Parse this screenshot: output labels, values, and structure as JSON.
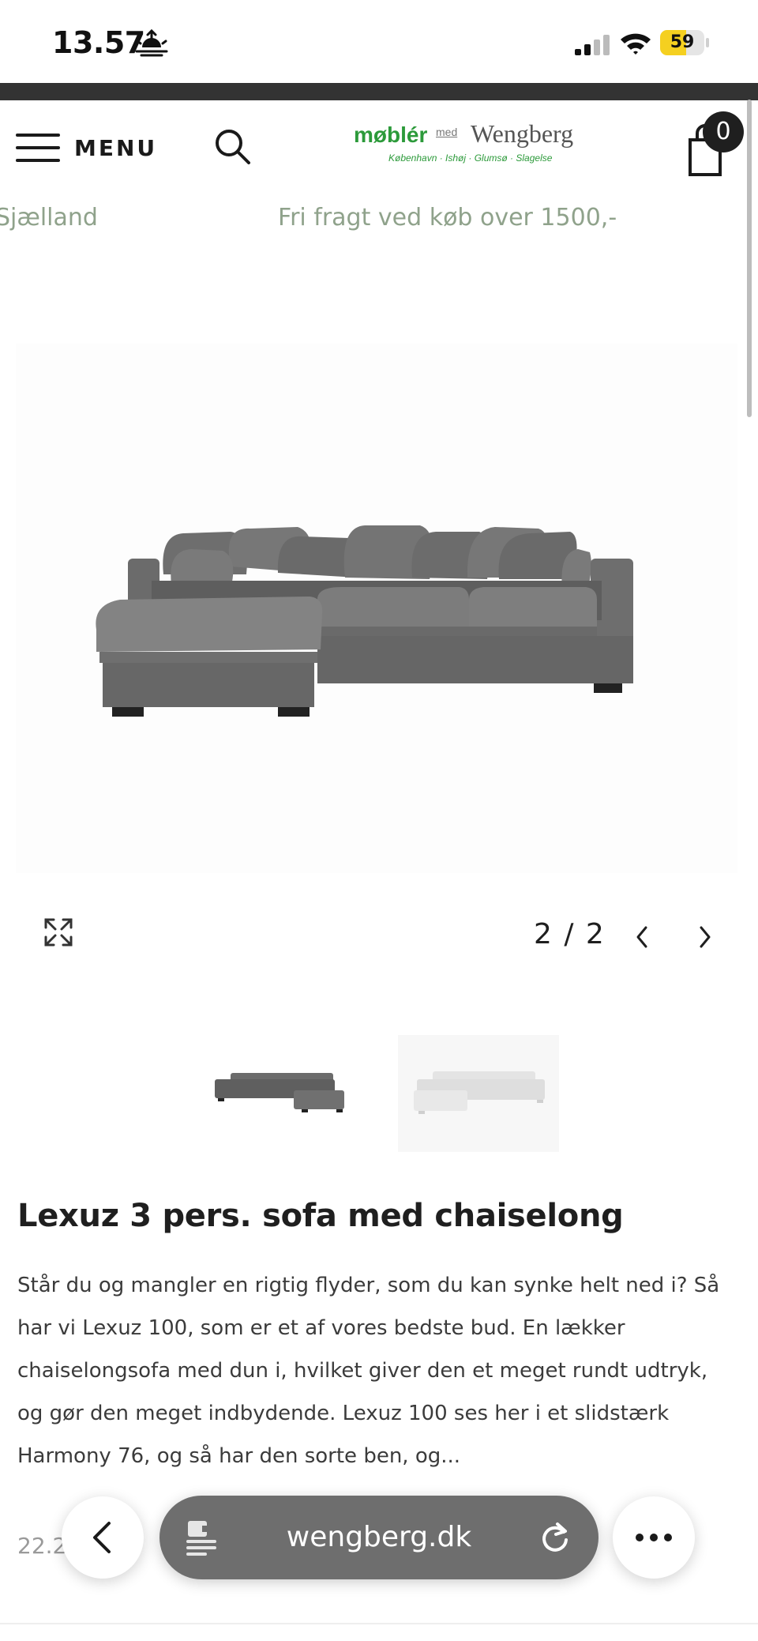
{
  "status": {
    "time": "13.57",
    "battery_percent": "59",
    "battery_level": 0.59,
    "battery_color": "#f5d020",
    "icons": [
      "sunset-icon",
      "signal-icon",
      "wifi-icon",
      "battery-icon"
    ]
  },
  "header": {
    "menu_label": "MENU",
    "logo": {
      "main": "møblér",
      "med": "med",
      "brand": "Wengberg",
      "cities": "København · Ishøj · Glumsø · Slagelse"
    },
    "cart_count": "0",
    "brand_green": "#2c9a3a"
  },
  "marquee": {
    "left_text": "Sjælland",
    "right_text": "Fri fragt ved køb over 1500,-"
  },
  "gallery": {
    "counter": "2 / 2",
    "thumbnails": [
      "grey-sofa-thumbnail",
      "white-sofa-thumbnail"
    ]
  },
  "product": {
    "title": "Lexuz 3 pers. sofa med chaiselong",
    "description_lines": [
      "Står du og mangler en rigtig flyder, som du kan synke helt ned i? Så",
      "har vi Lexuz 100, som er et af vores bedste bud. En lækker",
      "chaiselongsofa med dun i, hvilket giver den et meget rundt udtryk,",
      "og gør den meget indbydende. Lexuz 100 ses her i et slidstærk",
      "Harmony 76, og så har den sorte ben, og..."
    ],
    "price_peek": "22.2"
  },
  "browser": {
    "url": "wengberg.dk"
  }
}
